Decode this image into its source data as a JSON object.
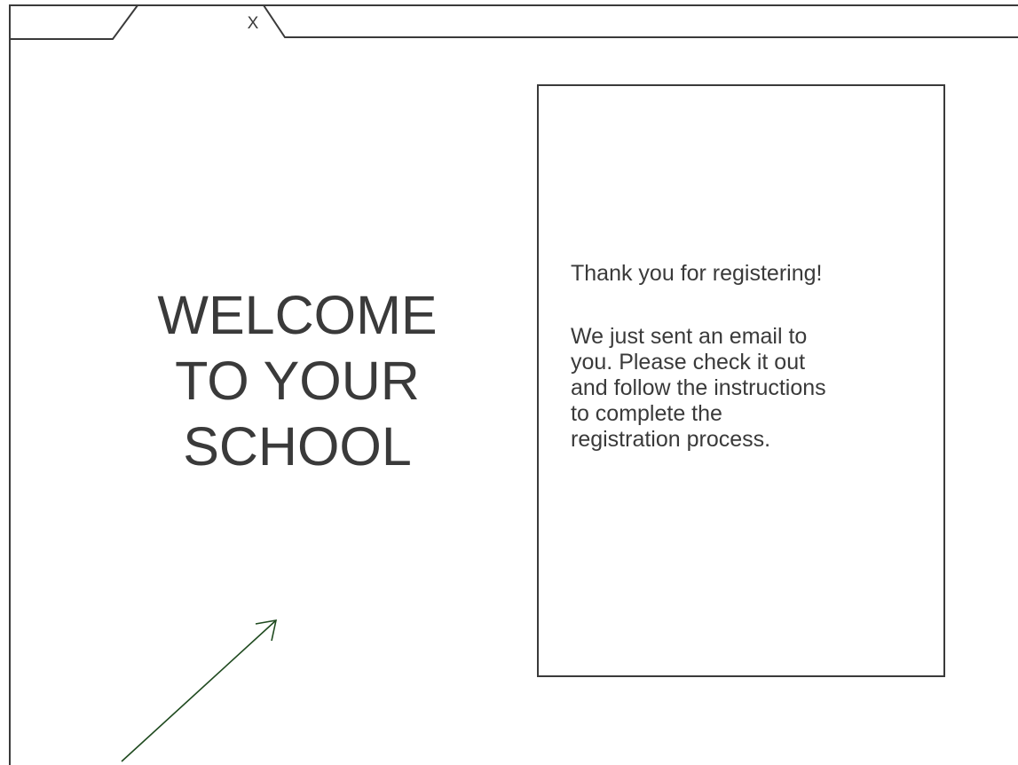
{
  "window": {
    "tab_close_label": "X"
  },
  "welcome": {
    "lines": [
      "WELCOME",
      "TO YOUR",
      "SCHOOL"
    ]
  },
  "registration_message": {
    "heading": "Thank you for registering!",
    "body_lines": [
      "We just sent an email to",
      "you. Please check it out",
      "and follow the instructions",
      "to complete the",
      "registration process."
    ]
  },
  "colors": {
    "stroke": "#3a3a3a",
    "arrow": "#1f4a1f",
    "background": "#ffffff"
  },
  "icons": {
    "annotation_arrow": "arrow-up-right-icon"
  }
}
